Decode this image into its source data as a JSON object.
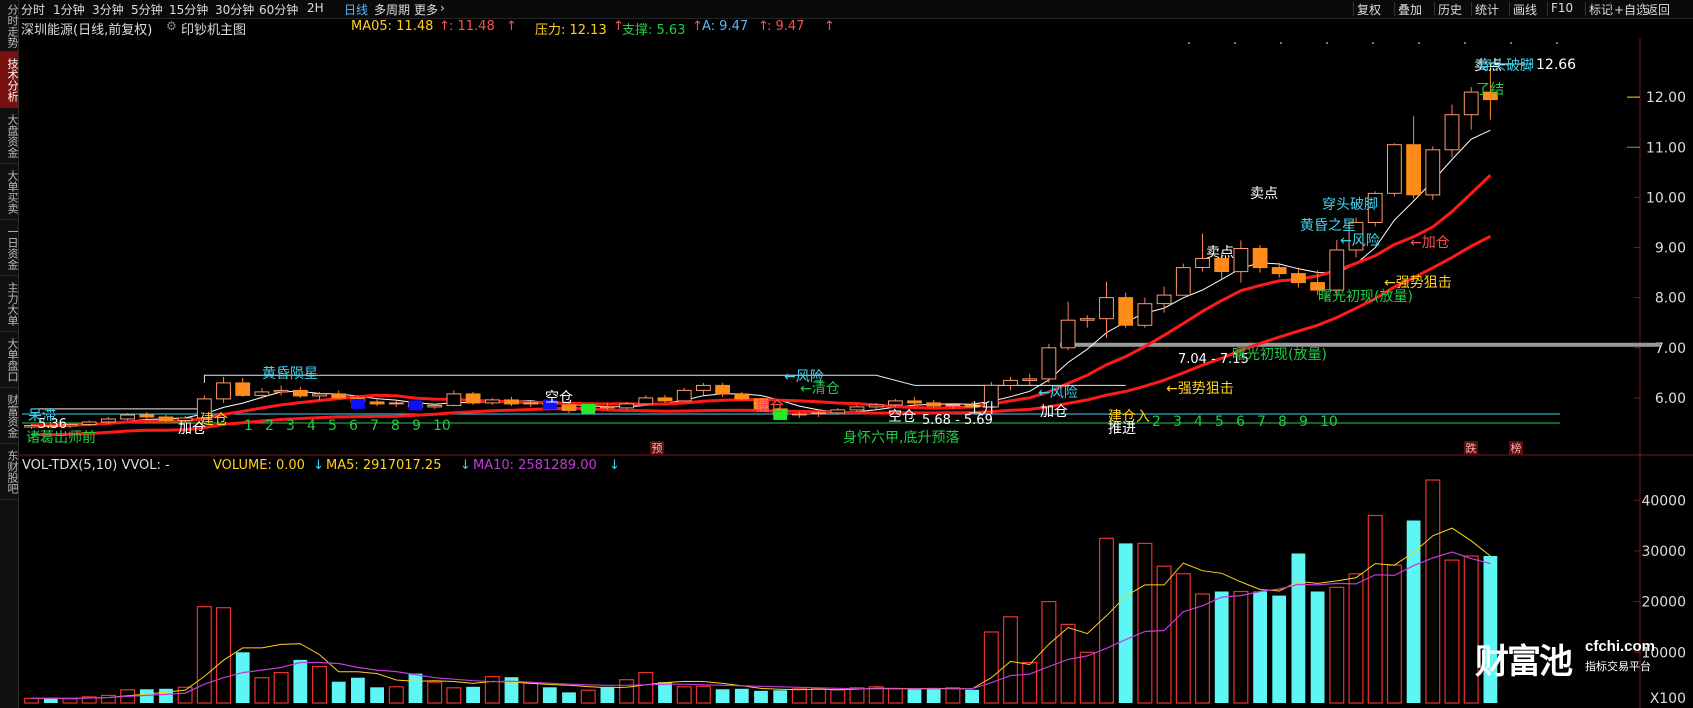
{
  "sidebar": {
    "items": [
      {
        "label": "分时走势",
        "active": false
      },
      {
        "label": "技术分析",
        "active": true
      },
      {
        "label": "大盘资金",
        "active": false
      },
      {
        "label": "大单买卖",
        "active": false
      },
      {
        "label": "一日资金",
        "active": false
      },
      {
        "label": "主力大单",
        "active": false
      },
      {
        "label": "大单盘口",
        "active": false
      },
      {
        "label": "财富资金",
        "active": false
      },
      {
        "label": "东财股吧",
        "active": false
      }
    ]
  },
  "toolbar": {
    "periods": [
      "分时",
      "1分钟",
      "3分钟",
      "5分钟",
      "15分钟",
      "30分钟",
      "60分钟",
      "2H",
      "日线",
      "多周期",
      "更多"
    ],
    "active_period": "日线",
    "more_suffix": "›",
    "tools": [
      "复权",
      "叠加",
      "历史",
      "统计",
      "画线",
      "F10",
      "标记",
      "+自选",
      "返回"
    ]
  },
  "header": {
    "stock_name": "深圳能源(日线,前复权)",
    "indicator_name": "印钞机主图",
    "ma05": "MA05: 11.48",
    "ma05_arrow": "↑",
    "ma05_second": ": 11.48",
    "pressure": "压力: 12.13",
    "support": "支撑: 5.63",
    "a_value": "A: 9.47",
    "a_second": ": 9.47",
    "arrow_up": "↑"
  },
  "volume_header": {
    "title": "VOL-TDX(5,10) VVOL: -",
    "volume": "VOLUME: 0.00",
    "ma5": "MA5: 2917017.25",
    "ma10": "MA10: 2581289.00",
    "arrow_down": "↓"
  },
  "colors": {
    "up": "#ff4d4d",
    "down_fill": "#ff8c1a",
    "vol_up": "#e8322e",
    "vol_down": "#5ef5f5",
    "ma5": "#ffffff",
    "ma_red": "#ff1a1a",
    "yellow": "#ffd11a",
    "green": "#22cc44",
    "cyan": "#3fd4f0",
    "magenta": "#c23cd8",
    "accent_blue": "#57b8ff",
    "sidebar_active": "#7a1010"
  },
  "chart_data": [
    {
      "type": "candlestick",
      "title": "深圳能源(日线,前复权)",
      "yaxis_ticks": [
        "12.00",
        "11.00",
        "10.00",
        "9.00",
        "8.00",
        "7.00",
        "6.00"
      ],
      "ylim": [
        5.3,
        12.9
      ],
      "max_label": "12.66",
      "range_labels": [
        "7.04 - 7.15",
        "5.68 - 5.69",
        "5.36"
      ],
      "candles": [
        {
          "o": 5.42,
          "h": 5.48,
          "l": 5.38,
          "c": 5.45
        },
        {
          "o": 5.45,
          "h": 5.52,
          "l": 5.4,
          "c": 5.44
        },
        {
          "o": 5.44,
          "h": 5.5,
          "l": 5.4,
          "c": 5.47
        },
        {
          "o": 5.47,
          "h": 5.55,
          "l": 5.44,
          "c": 5.52
        },
        {
          "o": 5.52,
          "h": 5.62,
          "l": 5.48,
          "c": 5.58
        },
        {
          "o": 5.58,
          "h": 5.7,
          "l": 5.55,
          "c": 5.66
        },
        {
          "o": 5.66,
          "h": 5.72,
          "l": 5.58,
          "c": 5.62
        },
        {
          "o": 5.62,
          "h": 5.66,
          "l": 5.52,
          "c": 5.55
        },
        {
          "o": 5.55,
          "h": 5.64,
          "l": 5.5,
          "c": 5.6
        },
        {
          "o": 5.6,
          "h": 6.05,
          "l": 5.58,
          "c": 5.98
        },
        {
          "o": 5.98,
          "h": 6.42,
          "l": 5.9,
          "c": 6.3
        },
        {
          "o": 6.3,
          "h": 6.4,
          "l": 6.02,
          "c": 6.05
        },
        {
          "o": 6.05,
          "h": 6.2,
          "l": 5.98,
          "c": 6.12
        },
        {
          "o": 6.12,
          "h": 6.25,
          "l": 6.05,
          "c": 6.15
        },
        {
          "o": 6.15,
          "h": 6.22,
          "l": 6.0,
          "c": 6.04
        },
        {
          "o": 6.04,
          "h": 6.12,
          "l": 5.95,
          "c": 6.08
        },
        {
          "o": 6.08,
          "h": 6.15,
          "l": 5.98,
          "c": 6.0
        },
        {
          "o": 6.0,
          "h": 6.05,
          "l": 5.88,
          "c": 5.92
        },
        {
          "o": 5.92,
          "h": 5.98,
          "l": 5.84,
          "c": 5.88
        },
        {
          "o": 5.88,
          "h": 5.95,
          "l": 5.82,
          "c": 5.9
        },
        {
          "o": 5.9,
          "h": 5.94,
          "l": 5.78,
          "c": 5.82
        },
        {
          "o": 5.82,
          "h": 5.88,
          "l": 5.78,
          "c": 5.85
        },
        {
          "o": 5.85,
          "h": 6.15,
          "l": 5.83,
          "c": 6.08
        },
        {
          "o": 6.08,
          "h": 6.12,
          "l": 5.86,
          "c": 5.9
        },
        {
          "o": 5.9,
          "h": 6.0,
          "l": 5.86,
          "c": 5.96
        },
        {
          "o": 5.96,
          "h": 6.02,
          "l": 5.84,
          "c": 5.88
        },
        {
          "o": 5.88,
          "h": 5.94,
          "l": 5.82,
          "c": 5.9
        },
        {
          "o": 5.9,
          "h": 5.96,
          "l": 5.84,
          "c": 5.86
        },
        {
          "o": 5.86,
          "h": 5.92,
          "l": 5.7,
          "c": 5.75
        },
        {
          "o": 5.75,
          "h": 5.85,
          "l": 5.72,
          "c": 5.82
        },
        {
          "o": 5.82,
          "h": 5.9,
          "l": 5.76,
          "c": 5.8
        },
        {
          "o": 5.8,
          "h": 5.92,
          "l": 5.78,
          "c": 5.88
        },
        {
          "o": 5.88,
          "h": 6.05,
          "l": 5.86,
          "c": 6.0
        },
        {
          "o": 6.0,
          "h": 6.06,
          "l": 5.9,
          "c": 5.94
        },
        {
          "o": 5.94,
          "h": 6.2,
          "l": 5.92,
          "c": 6.15
        },
        {
          "o": 6.15,
          "h": 6.3,
          "l": 6.05,
          "c": 6.25
        },
        {
          "o": 6.25,
          "h": 6.3,
          "l": 6.02,
          "c": 6.08
        },
        {
          "o": 6.08,
          "h": 6.12,
          "l": 5.95,
          "c": 5.98
        },
        {
          "o": 5.98,
          "h": 6.0,
          "l": 5.72,
          "c": 5.78
        },
        {
          "o": 5.78,
          "h": 5.82,
          "l": 5.62,
          "c": 5.66
        },
        {
          "o": 5.66,
          "h": 5.72,
          "l": 5.6,
          "c": 5.68
        },
        {
          "o": 5.68,
          "h": 5.74,
          "l": 5.62,
          "c": 5.7
        },
        {
          "o": 5.7,
          "h": 5.8,
          "l": 5.66,
          "c": 5.76
        },
        {
          "o": 5.76,
          "h": 5.86,
          "l": 5.72,
          "c": 5.82
        },
        {
          "o": 5.82,
          "h": 5.9,
          "l": 5.76,
          "c": 5.86
        },
        {
          "o": 5.86,
          "h": 5.98,
          "l": 5.82,
          "c": 5.94
        },
        {
          "o": 5.94,
          "h": 6.02,
          "l": 5.86,
          "c": 5.9
        },
        {
          "o": 5.9,
          "h": 5.96,
          "l": 5.8,
          "c": 5.84
        },
        {
          "o": 5.84,
          "h": 5.9,
          "l": 5.78,
          "c": 5.86
        },
        {
          "o": 5.86,
          "h": 5.92,
          "l": 5.8,
          "c": 5.82
        },
        {
          "o": 5.82,
          "h": 6.32,
          "l": 5.76,
          "c": 6.25
        },
        {
          "o": 6.25,
          "h": 6.42,
          "l": 6.15,
          "c": 6.35
        },
        {
          "o": 6.35,
          "h": 6.48,
          "l": 6.25,
          "c": 6.38
        },
        {
          "o": 6.38,
          "h": 7.08,
          "l": 6.3,
          "c": 7.0
        },
        {
          "o": 7.0,
          "h": 7.92,
          "l": 6.95,
          "c": 7.55
        },
        {
          "o": 7.55,
          "h": 7.65,
          "l": 7.4,
          "c": 7.58
        },
        {
          "o": 7.58,
          "h": 8.32,
          "l": 7.2,
          "c": 8.0
        },
        {
          "o": 8.0,
          "h": 8.1,
          "l": 7.4,
          "c": 7.45
        },
        {
          "o": 7.45,
          "h": 8.0,
          "l": 7.4,
          "c": 7.88
        },
        {
          "o": 7.88,
          "h": 8.22,
          "l": 7.7,
          "c": 8.05
        },
        {
          "o": 8.05,
          "h": 8.68,
          "l": 8.05,
          "c": 8.6
        },
        {
          "o": 8.6,
          "h": 9.28,
          "l": 8.52,
          "c": 8.78
        },
        {
          "o": 8.78,
          "h": 8.9,
          "l": 8.38,
          "c": 8.52
        },
        {
          "o": 8.52,
          "h": 9.14,
          "l": 8.3,
          "c": 8.98
        },
        {
          "o": 8.98,
          "h": 9.05,
          "l": 8.5,
          "c": 8.6
        },
        {
          "o": 8.6,
          "h": 8.7,
          "l": 8.4,
          "c": 8.48
        },
        {
          "o": 8.48,
          "h": 8.6,
          "l": 8.2,
          "c": 8.3
        },
        {
          "o": 8.3,
          "h": 8.55,
          "l": 8.05,
          "c": 8.15
        },
        {
          "o": 8.15,
          "h": 9.15,
          "l": 8.0,
          "c": 8.95
        },
        {
          "o": 8.95,
          "h": 9.6,
          "l": 8.8,
          "c": 9.5
        },
        {
          "o": 9.5,
          "h": 10.12,
          "l": 9.42,
          "c": 10.08
        },
        {
          "o": 10.08,
          "h": 11.08,
          "l": 10.02,
          "c": 11.05
        },
        {
          "o": 11.05,
          "h": 11.62,
          "l": 9.98,
          "c": 10.05
        },
        {
          "o": 10.05,
          "h": 11.02,
          "l": 9.95,
          "c": 10.95
        },
        {
          "o": 10.95,
          "h": 11.85,
          "l": 10.8,
          "c": 11.65
        },
        {
          "o": 11.65,
          "h": 12.2,
          "l": 11.35,
          "c": 12.1
        },
        {
          "o": 12.1,
          "h": 12.66,
          "l": 11.55,
          "c": 11.95
        }
      ]
    },
    {
      "type": "bar",
      "title": "VOL-TDX(5,10) VVOL: -",
      "yaxis_ticks": [
        "40000",
        "30000",
        "20000",
        "10000"
      ],
      "unit_label": "X100",
      "ylim": [
        0,
        44000
      ],
      "series": [
        {
          "name": "VOLUME",
          "values": [
            900,
            1000,
            800,
            1200,
            1500,
            2600,
            2700,
            2800,
            3100,
            19000,
            18800,
            10000,
            5000,
            6000,
            8500,
            7200,
            4200,
            5000,
            3100,
            3200,
            5800,
            4100,
            3000,
            3200,
            5200,
            5100,
            3900,
            3100,
            2100,
            2500,
            3200,
            4600,
            6000,
            4100,
            3200,
            3300,
            2700,
            2800,
            2400,
            2500,
            2800,
            2800,
            2600,
            3000,
            3200,
            2800,
            2700,
            2900,
            3000,
            2600,
            14000,
            17000,
            8000,
            20000,
            15500,
            10000,
            32500,
            31500,
            31500,
            27000,
            25500,
            21500,
            22000,
            22000,
            22000,
            21200,
            29500,
            22000,
            22800,
            25500,
            37000,
            27200,
            36000,
            44000,
            28200,
            29000,
            29000
          ]
        },
        {
          "name": "MA5",
          "values": [
            900,
            950,
            900,
            980,
            1080,
            1420,
            1760,
            2160,
            2540,
            5240,
            8440,
            10880,
            10880,
            11560,
            11700,
            9540,
            6180,
            6180,
            5800,
            4540,
            4260,
            4400,
            4240,
            3860,
            4260,
            4120,
            3900,
            3660,
            3500,
            3240,
            3000,
            3100,
            3600,
            4020,
            4260,
            4240,
            3860,
            3420,
            2880,
            2700,
            2600,
            2740,
            2600,
            2700,
            2900,
            2880,
            2840,
            2880,
            2840,
            2800,
            5000,
            8200,
            7600,
            11600,
            14900,
            13700,
            17200,
            21100,
            23300,
            23300,
            27600,
            26100,
            25600,
            23900,
            22400,
            22100,
            24000,
            23600,
            24100,
            24700,
            27500,
            27200,
            29700,
            33000,
            34500,
            32000,
            29000
          ]
        },
        {
          "name": "MA10",
          "values": [
            900,
            950,
            900,
            980,
            1080,
            1300,
            1500,
            1700,
            1950,
            3700,
            5000,
            6000,
            6500,
            7000,
            8000,
            8000,
            7800,
            7000,
            6500,
            6200,
            5600,
            5000,
            4700,
            4400,
            4200,
            4300,
            4100,
            3900,
            3700,
            3600,
            3500,
            3500,
            3600,
            3700,
            3700,
            3600,
            3500,
            3400,
            3300,
            3200,
            3100,
            3000,
            2900,
            2800,
            2800,
            2800,
            2800,
            2800,
            2800,
            2800,
            4000,
            5400,
            5700,
            7200,
            8600,
            9300,
            10800,
            12500,
            14100,
            14300,
            18000,
            19200,
            20900,
            21200,
            22000,
            22500,
            23400,
            23300,
            23600,
            23500,
            25300,
            25200,
            27100,
            28600,
            29800,
            28500,
            27500
          ]
        }
      ]
    }
  ],
  "annotations": {
    "price": [
      {
        "text": "呆滞",
        "color": "#3fd4f0"
      },
      {
        "text": "诸葛出师前",
        "color": "#22cc44"
      },
      {
        "text": "建仓",
        "color": "#ffd11a"
      },
      {
        "text": "加仓",
        "color": "#ffffff"
      },
      {
        "text": "黄昏陨星",
        "color": "#3fd4f0"
      },
      {
        "text": "空仓",
        "color": "#ffffff"
      },
      {
        "text": "←风险",
        "color": "#3fd4f0"
      },
      {
        "text": "←清仓",
        "color": "#22cc44"
      },
      {
        "text": "建仓",
        "color": "#ff4d4d"
      },
      {
        "text": "加仓",
        "color": "#ff4d4d"
      },
      {
        "text": "身怀六甲,底升预落",
        "color": "#22cc44"
      },
      {
        "text": "空仓",
        "color": "#ffffff"
      },
      {
        "text": "上升",
        "color": "#ffffff"
      },
      {
        "text": "←风险",
        "color": "#3fd4f0"
      },
      {
        "text": "加仓",
        "color": "#ffffff"
      },
      {
        "text": "建仓入",
        "color": "#ffd11a"
      },
      {
        "text": "推进",
        "color": "#ffffff"
      },
      {
        "text": "←强势狙击",
        "color": "#ffd11a"
      },
      {
        "text": "曙光初现(放量)",
        "color": "#22cc44"
      },
      {
        "text": "卖点",
        "color": "#ffffff"
      },
      {
        "text": "卖点",
        "color": "#ffffff"
      },
      {
        "text": "黄昏之星",
        "color": "#3fd4f0"
      },
      {
        "text": "穿头破脚",
        "color": "#3fd4f0"
      },
      {
        "text": "←风险",
        "color": "#3fd4f0"
      },
      {
        "text": "←加仓",
        "color": "#ff4d4d"
      },
      {
        "text": "曙光初现(放量)",
        "color": "#22cc44"
      },
      {
        "text": "←强势狙击",
        "color": "#ffd11a"
      },
      {
        "text": "卖点",
        "color": "#ffffff"
      },
      {
        "text": "穿头破脚",
        "color": "#3fd4f0"
      },
      {
        "text": "了结",
        "color": "#22cc44"
      }
    ],
    "counter_row": [
      "1",
      "2",
      "3",
      "4",
      "5",
      "6",
      "7",
      "8",
      "9",
      "10"
    ],
    "counter_row_2": [
      "2",
      "3",
      "4",
      "5",
      "6",
      "7",
      "8",
      "9",
      "10"
    ],
    "markers": [
      "预",
      "跌",
      "榜"
    ]
  }
}
